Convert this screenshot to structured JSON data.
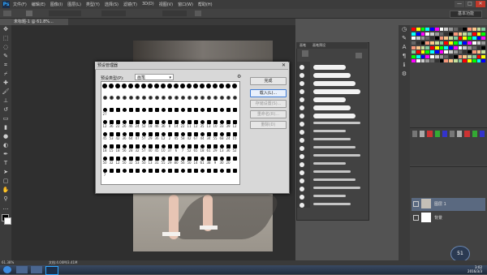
{
  "app": {
    "logo": "Ps"
  },
  "menu": [
    "文件(F)",
    "编辑(E)",
    "图像(I)",
    "图层(L)",
    "类型(Y)",
    "选择(S)",
    "滤镜(T)",
    "3D(D)",
    "视图(V)",
    "窗口(W)",
    "帮助(H)"
  ],
  "window_buttons": [
    "—",
    "□",
    "✕"
  ],
  "options_bar": {
    "workspace": "基本功能"
  },
  "document": {
    "tab": "未标题-1 @ 61.8%...",
    "zoom": "61.38%",
    "doc_info": "文档:4.00M/3.41M"
  },
  "brush_panel": {
    "tabs": [
      "画笔",
      "画笔预设"
    ]
  },
  "dialog": {
    "title": "预设管理器",
    "preset_type_label": "预设类型(P):",
    "preset_type_value": "画笔",
    "close": "✕",
    "buttons": {
      "done": "完成",
      "load": "载入(L)...",
      "save": "存储设置(S)...",
      "rename": "重命名(R)...",
      "delete": "删除(D)"
    },
    "brush_sizes": [
      "",
      "",
      "",
      "",
      "",
      "",
      "",
      "",
      "",
      "",
      "",
      "",
      "",
      "",
      "",
      "",
      "",
      "",
      "",
      "",
      "",
      "",
      "",
      "",
      "",
      "",
      "",
      "",
      "",
      "",
      "",
      "",
      "",
      "",
      "",
      "",
      "",
      "",
      "",
      "",
      "",
      "",
      "27",
      "",
      "",
      "",
      "",
      "",
      "",
      "",
      "",
      "",
      "",
      "",
      "",
      "",
      "",
      "",
      "",
      "",
      "",
      "",
      "",
      "12",
      "36",
      "22",
      "26",
      "46",
      "24",
      "52",
      "18",
      "46",
      "36",
      "8",
      "14",
      "22",
      "11",
      "12",
      "35",
      "13",
      "10",
      "33",
      "39",
      "12",
      "45",
      "53",
      "42",
      "36",
      "64",
      "47",
      "57",
      "29",
      "36",
      "12",
      "2",
      "45",
      "58",
      "42",
      "67",
      "44",
      "34",
      "55",
      "68",
      "24",
      "15",
      "18",
      "15",
      "18",
      "56",
      "28",
      "32",
      "57",
      "40",
      "45",
      "10",
      "37",
      "6",
      "7",
      "52",
      "65",
      "18",
      "61",
      "29",
      "13",
      "36",
      "52",
      "50",
      "32",
      "12",
      "50",
      "32",
      "53",
      "50",
      "13",
      "31",
      "55",
      "29",
      "80",
      "56",
      "50",
      "14",
      "61",
      "38",
      "9",
      "30",
      "20",
      "",
      "7",
      "",
      "",
      "",
      "",
      "",
      "",
      "",
      "",
      "",
      "",
      "",
      "",
      "",
      "",
      "",
      "",
      "",
      "",
      "",
      ""
    ]
  },
  "layers": [
    {
      "name": "图层 1"
    },
    {
      "name": "背景"
    }
  ],
  "taskbar": {
    "time": "3:02",
    "date": "2016/3/3"
  },
  "nav_badge": "51",
  "colors": {
    "accent": "#31a8ff",
    "canvas": "#2f2f2f",
    "dialog": "#d8d8d8"
  }
}
